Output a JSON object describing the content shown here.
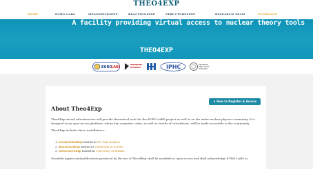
{
  "brand": "THEO4EXP",
  "nav": [
    {
      "label": "HOME",
      "active": true
    },
    {
      "label": "EURO-LABS",
      "active": false
    },
    {
      "label": "MEANFIELD4EXP",
      "active": false
    },
    {
      "label": "REACTION4EXP",
      "active": false
    },
    {
      "label": "STRUCTURE4EXP",
      "active": false
    },
    {
      "label": "RESEARCH TEAM",
      "active": false
    },
    {
      "label": "OUTREACH",
      "active": true
    }
  ],
  "hero": {
    "tagline": "A facility providing virtual access to nuclear theory tools",
    "title": "THEO4EXP"
  },
  "logos": [
    "EURO-LABS",
    "UNIVERSIDAD DE SEVILLA",
    "IFJ",
    "IPHC",
    "UNIVERSITÀ DEGLI STUDI DI MILANO"
  ],
  "card": {
    "register_label": "How to Register & Access",
    "heading": "About Theo4Exp",
    "intro": "Theo4Exp virtual infrastructure will provide theoretical tools for the EURO-LABS project as well as on the wider nuclear physics community. It is designed as an open-access platform, where key computer codes, as well as results of calculations, will be made accessible to the community.",
    "includes": "Theo4Exp includes three installations:",
    "items": [
      {
        "num": "1.",
        "name": "MeanField4Exp",
        "hosted": "hosted at",
        "place": "IFJ PAN Krakow."
      },
      {
        "num": "2.",
        "name": "Reaction4Exp",
        "hosted": "hosted at",
        "place": "University of Seville."
      },
      {
        "num": "3.",
        "name": "Structure4Exp",
        "hosted": "hosted at",
        "place": "University of Milano."
      }
    ],
    "footer": "Scientific papers and publications produced by the use of Theo4Exp shall be available in open access and shall acknowledge EURO-LABS ac"
  },
  "colors": {
    "accent": "#1d8aa6",
    "nav_active": "#e0a020",
    "hero": "#1197bb"
  }
}
